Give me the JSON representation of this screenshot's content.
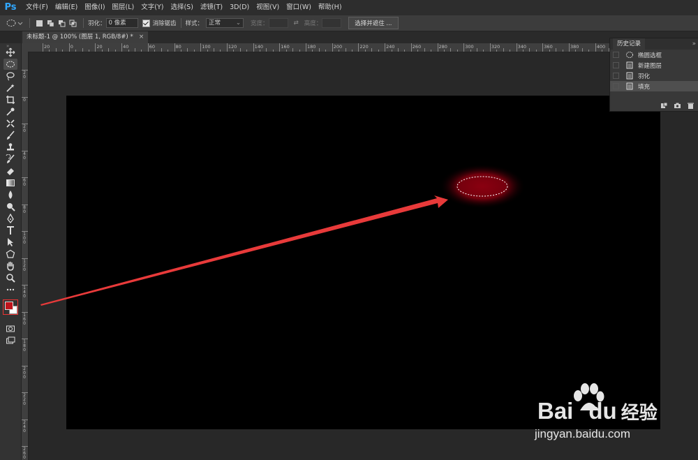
{
  "app": {
    "logo": "Ps"
  },
  "menu": [
    "文件(F)",
    "编辑(E)",
    "图像(I)",
    "图层(L)",
    "文字(Y)",
    "选择(S)",
    "滤镜(T)",
    "3D(D)",
    "视图(V)",
    "窗口(W)",
    "帮助(H)"
  ],
  "options": {
    "feather_label": "羽化：",
    "feather_value": "0 像素",
    "antialias_label": "消除锯齿",
    "style_label": "样式：",
    "style_value": "正常",
    "width_label": "宽度：",
    "height_label": "高度：",
    "select_mask_button": "选择并遮住 ..."
  },
  "document": {
    "tab_title": "未标题-1 @ 100% (图层 1, RGB/8#) *",
    "close": "×"
  },
  "ruler_h": [
    "20",
    "0",
    "20",
    "40",
    "60",
    "80",
    "100",
    "120",
    "140",
    "160",
    "180",
    "200",
    "220",
    "240",
    "260",
    "280",
    "300",
    "320",
    "340",
    "360",
    "380",
    "400"
  ],
  "ruler_v": [
    "2 0",
    "0",
    "2 0",
    "4 0",
    "6 0",
    "8 0",
    "1 0 0",
    "1 2 0",
    "1 4 0",
    "1 6 0",
    "1 8 0",
    "2 0 0",
    "2 2 0",
    "2 4 0",
    "2 6 0"
  ],
  "history": {
    "title": "历史记录",
    "expand": "»",
    "items": [
      {
        "label": "椭圆选框",
        "icon": "ellipse-marquee-icon"
      },
      {
        "label": "新建图层",
        "icon": "document-icon"
      },
      {
        "label": "羽化",
        "icon": "document-icon"
      },
      {
        "label": "填充",
        "icon": "document-icon",
        "active": true
      }
    ]
  },
  "colors": {
    "foreground": "#c0141c",
    "background": "#ffffff",
    "glow": "#8a0010",
    "arrow": "#e83a3a",
    "canvas": "#000000"
  },
  "watermark": {
    "brand_a": "Bai",
    "brand_b": "du",
    "brand_cn": "经验",
    "url": "jingyan.baidu.com"
  }
}
